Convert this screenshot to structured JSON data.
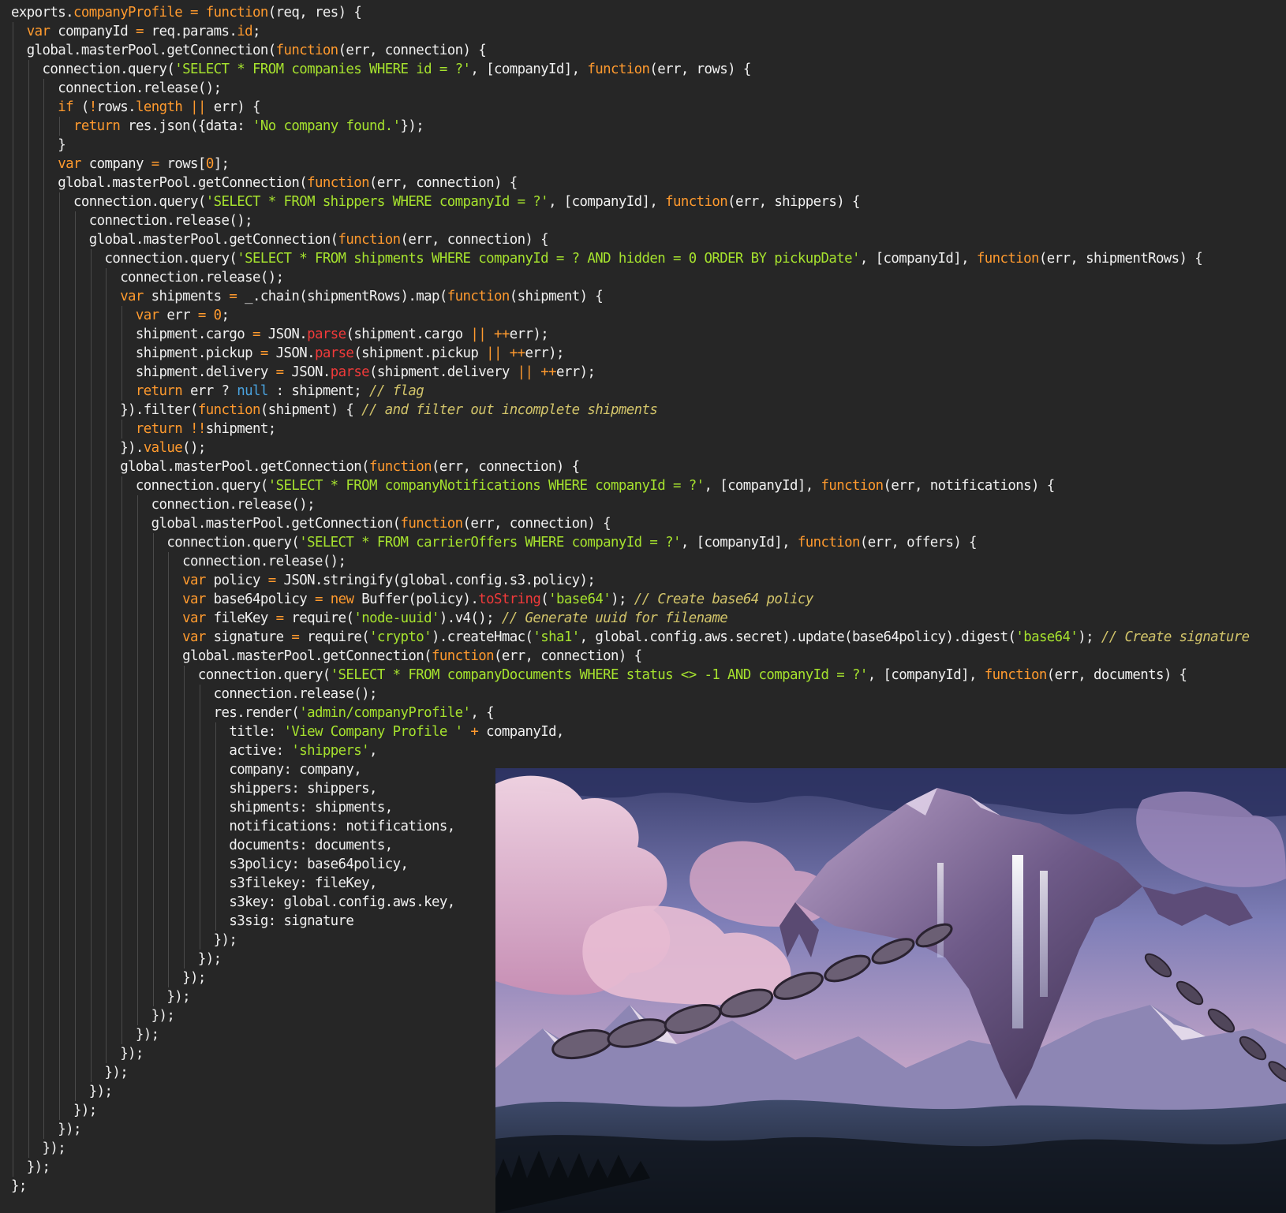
{
  "colors": {
    "background": "#262626",
    "plain": "#f0f0f0",
    "keyword": "#ff9a2e",
    "string": "#a6e22e",
    "comment": "#d2c46a",
    "null": "#4aa3df",
    "method": "#f03a3a"
  },
  "code": {
    "lines": [
      {
        "indent": 0,
        "tokens": [
          [
            "pl",
            "exports."
          ],
          [
            "kw",
            "companyProfile"
          ],
          [
            "pl",
            " "
          ],
          [
            "op",
            "="
          ],
          [
            "pl",
            " "
          ],
          [
            "kw",
            "function"
          ],
          [
            "pl",
            "(req, res) {"
          ]
        ]
      },
      {
        "indent": 1,
        "tokens": [
          [
            "kw",
            "var"
          ],
          [
            "pl",
            " companyId "
          ],
          [
            "op",
            "="
          ],
          [
            "pl",
            " req.params."
          ],
          [
            "kw",
            "id"
          ],
          [
            "pl",
            ";"
          ]
        ]
      },
      {
        "indent": 1,
        "tokens": [
          [
            "pl",
            "global.masterPool.getConnection("
          ],
          [
            "kw",
            "function"
          ],
          [
            "pl",
            "(err, connection) {"
          ]
        ]
      },
      {
        "indent": 2,
        "tokens": [
          [
            "pl",
            "connection.query("
          ],
          [
            "str",
            "'SELECT * FROM companies WHERE id = ?'"
          ],
          [
            "pl",
            ", [companyId], "
          ],
          [
            "kw",
            "function"
          ],
          [
            "pl",
            "(err, rows) {"
          ]
        ]
      },
      {
        "indent": 3,
        "tokens": [
          [
            "pl",
            "connection.release();"
          ]
        ]
      },
      {
        "indent": 3,
        "tokens": [
          [
            "kw",
            "if"
          ],
          [
            "pl",
            " ("
          ],
          [
            "op",
            "!"
          ],
          [
            "pl",
            "rows."
          ],
          [
            "kw",
            "length"
          ],
          [
            "pl",
            " "
          ],
          [
            "op",
            "||"
          ],
          [
            "pl",
            " err) {"
          ]
        ]
      },
      {
        "indent": 4,
        "tokens": [
          [
            "kw",
            "return"
          ],
          [
            "pl",
            " res.json({data: "
          ],
          [
            "str",
            "'No company found.'"
          ],
          [
            "pl",
            "});"
          ]
        ]
      },
      {
        "indent": 3,
        "tokens": [
          [
            "pl",
            "}"
          ]
        ]
      },
      {
        "indent": 3,
        "tokens": [
          [
            "kw",
            "var"
          ],
          [
            "pl",
            " company "
          ],
          [
            "op",
            "="
          ],
          [
            "pl",
            " rows["
          ],
          [
            "num",
            "0"
          ],
          [
            "pl",
            "];"
          ]
        ]
      },
      {
        "indent": 3,
        "tokens": [
          [
            "pl",
            "global.masterPool.getConnection("
          ],
          [
            "kw",
            "function"
          ],
          [
            "pl",
            "(err, connection) {"
          ]
        ]
      },
      {
        "indent": 4,
        "tokens": [
          [
            "pl",
            "connection.query("
          ],
          [
            "str",
            "'SELECT * FROM shippers WHERE companyId = ?'"
          ],
          [
            "pl",
            ", [companyId], "
          ],
          [
            "kw",
            "function"
          ],
          [
            "pl",
            "(err, shippers) {"
          ]
        ]
      },
      {
        "indent": 5,
        "tokens": [
          [
            "pl",
            "connection.release();"
          ]
        ]
      },
      {
        "indent": 5,
        "tokens": [
          [
            "pl",
            "global.masterPool.getConnection("
          ],
          [
            "kw",
            "function"
          ],
          [
            "pl",
            "(err, connection) {"
          ]
        ]
      },
      {
        "indent": 6,
        "tokens": [
          [
            "pl",
            "connection.query("
          ],
          [
            "str",
            "'SELECT * FROM shipments WHERE companyId = ? AND hidden = 0 ORDER BY pickupDate'"
          ],
          [
            "pl",
            ", [companyId], "
          ],
          [
            "kw",
            "function"
          ],
          [
            "pl",
            "(err, shipmentRows) {"
          ]
        ]
      },
      {
        "indent": 7,
        "tokens": [
          [
            "pl",
            "connection.release();"
          ]
        ]
      },
      {
        "indent": 7,
        "tokens": [
          [
            "kw",
            "var"
          ],
          [
            "pl",
            " shipments "
          ],
          [
            "op",
            "="
          ],
          [
            "pl",
            " _.chain(shipmentRows).map("
          ],
          [
            "kw",
            "function"
          ],
          [
            "pl",
            "(shipment) {"
          ]
        ]
      },
      {
        "indent": 8,
        "tokens": [
          [
            "kw",
            "var"
          ],
          [
            "pl",
            " err "
          ],
          [
            "op",
            "="
          ],
          [
            "pl",
            " "
          ],
          [
            "num",
            "0"
          ],
          [
            "pl",
            ";"
          ]
        ]
      },
      {
        "indent": 8,
        "tokens": [
          [
            "pl",
            "shipment.cargo "
          ],
          [
            "op",
            "="
          ],
          [
            "pl",
            " JSON."
          ],
          [
            "red",
            "parse"
          ],
          [
            "pl",
            "(shipment.cargo "
          ],
          [
            "op",
            "||"
          ],
          [
            "pl",
            " "
          ],
          [
            "op",
            "++"
          ],
          [
            "pl",
            "err);"
          ]
        ]
      },
      {
        "indent": 8,
        "tokens": [
          [
            "pl",
            "shipment.pickup "
          ],
          [
            "op",
            "="
          ],
          [
            "pl",
            " JSON."
          ],
          [
            "red",
            "parse"
          ],
          [
            "pl",
            "(shipment.pickup "
          ],
          [
            "op",
            "||"
          ],
          [
            "pl",
            " "
          ],
          [
            "op",
            "++"
          ],
          [
            "pl",
            "err);"
          ]
        ]
      },
      {
        "indent": 8,
        "tokens": [
          [
            "pl",
            "shipment.delivery "
          ],
          [
            "op",
            "="
          ],
          [
            "pl",
            " JSON."
          ],
          [
            "red",
            "parse"
          ],
          [
            "pl",
            "(shipment.delivery "
          ],
          [
            "op",
            "||"
          ],
          [
            "pl",
            " "
          ],
          [
            "op",
            "++"
          ],
          [
            "pl",
            "err);"
          ]
        ]
      },
      {
        "indent": 8,
        "tokens": [
          [
            "kw",
            "return"
          ],
          [
            "pl",
            " err ? "
          ],
          [
            "nul",
            "null"
          ],
          [
            "pl",
            " : shipment; "
          ],
          [
            "cm",
            "// flag"
          ]
        ]
      },
      {
        "indent": 7,
        "tokens": [
          [
            "pl",
            "}).filter("
          ],
          [
            "kw",
            "function"
          ],
          [
            "pl",
            "(shipment) { "
          ],
          [
            "cm",
            "// and filter out incomplete shipments"
          ]
        ]
      },
      {
        "indent": 8,
        "tokens": [
          [
            "kw",
            "return"
          ],
          [
            "pl",
            " "
          ],
          [
            "op",
            "!!"
          ],
          [
            "pl",
            "shipment;"
          ]
        ]
      },
      {
        "indent": 7,
        "tokens": [
          [
            "pl",
            "})."
          ],
          [
            "kw",
            "value"
          ],
          [
            "pl",
            "();"
          ]
        ]
      },
      {
        "indent": 7,
        "tokens": [
          [
            "pl",
            "global.masterPool.getConnection("
          ],
          [
            "kw",
            "function"
          ],
          [
            "pl",
            "(err, connection) {"
          ]
        ]
      },
      {
        "indent": 8,
        "tokens": [
          [
            "pl",
            "connection.query("
          ],
          [
            "str",
            "'SELECT * FROM companyNotifications WHERE companyId = ?'"
          ],
          [
            "pl",
            ", [companyId], "
          ],
          [
            "kw",
            "function"
          ],
          [
            "pl",
            "(err, notifications) {"
          ]
        ]
      },
      {
        "indent": 9,
        "tokens": [
          [
            "pl",
            "connection.release();"
          ]
        ]
      },
      {
        "indent": 9,
        "tokens": [
          [
            "pl",
            "global.masterPool.getConnection("
          ],
          [
            "kw",
            "function"
          ],
          [
            "pl",
            "(err, connection) {"
          ]
        ]
      },
      {
        "indent": 10,
        "tokens": [
          [
            "pl",
            "connection.query("
          ],
          [
            "str",
            "'SELECT * FROM carrierOffers WHERE companyId = ?'"
          ],
          [
            "pl",
            ", [companyId], "
          ],
          [
            "kw",
            "function"
          ],
          [
            "pl",
            "(err, offers) {"
          ]
        ]
      },
      {
        "indent": 11,
        "tokens": [
          [
            "pl",
            "connection.release();"
          ]
        ]
      },
      {
        "indent": 11,
        "tokens": [
          [
            "kw",
            "var"
          ],
          [
            "pl",
            " policy "
          ],
          [
            "op",
            "="
          ],
          [
            "pl",
            " JSON.stringify(global.config.s3.policy);"
          ]
        ]
      },
      {
        "indent": 11,
        "tokens": [
          [
            "kw",
            "var"
          ],
          [
            "pl",
            " base64policy "
          ],
          [
            "op",
            "="
          ],
          [
            "pl",
            " "
          ],
          [
            "kw",
            "new"
          ],
          [
            "pl",
            " Buffer(policy)."
          ],
          [
            "red",
            "toString"
          ],
          [
            "pl",
            "("
          ],
          [
            "str",
            "'base64'"
          ],
          [
            "pl",
            "); "
          ],
          [
            "cm",
            "// Create base64 policy"
          ]
        ]
      },
      {
        "indent": 11,
        "tokens": [
          [
            "kw",
            "var"
          ],
          [
            "pl",
            " fileKey "
          ],
          [
            "op",
            "="
          ],
          [
            "pl",
            " require("
          ],
          [
            "str",
            "'node-uuid'"
          ],
          [
            "pl",
            ").v4(); "
          ],
          [
            "cm",
            "// Generate uuid for filename"
          ]
        ]
      },
      {
        "indent": 11,
        "tokens": [
          [
            "kw",
            "var"
          ],
          [
            "pl",
            " signature "
          ],
          [
            "op",
            "="
          ],
          [
            "pl",
            " require("
          ],
          [
            "str",
            "'crypto'"
          ],
          [
            "pl",
            ").createHmac("
          ],
          [
            "str",
            "'sha1'"
          ],
          [
            "pl",
            ", global.config.aws.secret).update(base64policy).digest("
          ],
          [
            "str",
            "'base64'"
          ],
          [
            "pl",
            "); "
          ],
          [
            "cm",
            "// Create signature"
          ]
        ]
      },
      {
        "indent": 11,
        "tokens": [
          [
            "pl",
            "global.masterPool.getConnection("
          ],
          [
            "kw",
            "function"
          ],
          [
            "pl",
            "(err, connection) {"
          ]
        ]
      },
      {
        "indent": 12,
        "tokens": [
          [
            "pl",
            "connection.query("
          ],
          [
            "str",
            "'SELECT * FROM companyDocuments WHERE status <> -1 AND companyId = ?'"
          ],
          [
            "pl",
            ", [companyId], "
          ],
          [
            "kw",
            "function"
          ],
          [
            "pl",
            "(err, documents) {"
          ]
        ]
      },
      {
        "indent": 13,
        "tokens": [
          [
            "pl",
            "connection.release();"
          ]
        ]
      },
      {
        "indent": 13,
        "tokens": [
          [
            "pl",
            "res.render("
          ],
          [
            "str",
            "'admin/companyProfile'"
          ],
          [
            "pl",
            ", {"
          ]
        ]
      },
      {
        "indent": 14,
        "tokens": [
          [
            "pl",
            "title: "
          ],
          [
            "str",
            "'View Company Profile '"
          ],
          [
            "pl",
            " "
          ],
          [
            "op",
            "+"
          ],
          [
            "pl",
            " companyId,"
          ]
        ]
      },
      {
        "indent": 14,
        "tokens": [
          [
            "pl",
            "active: "
          ],
          [
            "str",
            "'shippers'"
          ],
          [
            "pl",
            ","
          ]
        ]
      },
      {
        "indent": 14,
        "tokens": [
          [
            "pl",
            "company: company,"
          ]
        ]
      },
      {
        "indent": 14,
        "tokens": [
          [
            "pl",
            "shippers: shippers,"
          ]
        ]
      },
      {
        "indent": 14,
        "tokens": [
          [
            "pl",
            "shipments: shipments,"
          ]
        ]
      },
      {
        "indent": 14,
        "tokens": [
          [
            "pl",
            "notifications: notifications,"
          ]
        ]
      },
      {
        "indent": 14,
        "tokens": [
          [
            "pl",
            "documents: documents,"
          ]
        ]
      },
      {
        "indent": 14,
        "tokens": [
          [
            "pl",
            "s3policy: base64policy,"
          ]
        ]
      },
      {
        "indent": 14,
        "tokens": [
          [
            "pl",
            "s3filekey: fileKey,"
          ]
        ]
      },
      {
        "indent": 14,
        "tokens": [
          [
            "pl",
            "s3key: global.config.aws.key,"
          ]
        ]
      },
      {
        "indent": 14,
        "tokens": [
          [
            "pl",
            "s3sig: signature"
          ]
        ]
      },
      {
        "indent": 13,
        "tokens": [
          [
            "pl",
            "});"
          ]
        ]
      },
      {
        "indent": 12,
        "tokens": [
          [
            "pl",
            "});"
          ]
        ]
      },
      {
        "indent": 11,
        "tokens": [
          [
            "pl",
            "});"
          ]
        ]
      },
      {
        "indent": 10,
        "tokens": [
          [
            "pl",
            "});"
          ]
        ]
      },
      {
        "indent": 9,
        "tokens": [
          [
            "pl",
            "});"
          ]
        ]
      },
      {
        "indent": 8,
        "tokens": [
          [
            "pl",
            "});"
          ]
        ]
      },
      {
        "indent": 7,
        "tokens": [
          [
            "pl",
            "});"
          ]
        ]
      },
      {
        "indent": 6,
        "tokens": [
          [
            "pl",
            "});"
          ]
        ]
      },
      {
        "indent": 5,
        "tokens": [
          [
            "pl",
            "});"
          ]
        ]
      },
      {
        "indent": 4,
        "tokens": [
          [
            "pl",
            "});"
          ]
        ]
      },
      {
        "indent": 3,
        "tokens": [
          [
            "pl",
            "});"
          ]
        ]
      },
      {
        "indent": 2,
        "tokens": [
          [
            "pl",
            "});"
          ]
        ]
      },
      {
        "indent": 1,
        "tokens": [
          [
            "pl",
            "});"
          ]
        ]
      },
      {
        "indent": 0,
        "tokens": [
          [
            "pl",
            "};"
          ]
        ]
      }
    ]
  },
  "image": {
    "description_icon": "fantasy-landscape-image"
  }
}
